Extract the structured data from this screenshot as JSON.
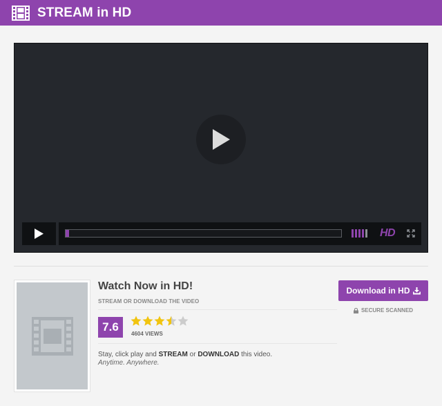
{
  "header": {
    "title": "STREAM in HD",
    "logo_icon": "film-strip-icon"
  },
  "player": {
    "big_play_icon": "play-icon",
    "controls": {
      "play_icon": "play-icon",
      "progress_fraction": 0.013,
      "volume_bars": 5,
      "volume_level_bars": 4,
      "hd_label": "HD",
      "fullscreen_icon": "fullscreen-icon"
    }
  },
  "video": {
    "title": "Watch Now in HD!",
    "subtitle": "STREAM OR DOWNLOAD THE VIDEO",
    "rating": "7.6",
    "stars": 3.5,
    "stars_max": 5,
    "views": "4604 VIEWS",
    "desc_prefix": "Stay, click play and ",
    "desc_stream": "STREAM",
    "desc_mid": " or ",
    "desc_download": "DOWNLOAD",
    "desc_suffix": " this video.",
    "tagline": "Anytime. Anywhere.",
    "poster_icon": "film-strip-icon"
  },
  "download": {
    "label": "Download in HD",
    "icon": "download-icon"
  },
  "secure": {
    "label": "SECURE SCANNED",
    "icon": "lock-icon"
  },
  "colors": {
    "accent": "#8e44ad",
    "star": "#f1c40f",
    "star_empty": "#cccccc",
    "player_bg": "#25282d"
  }
}
